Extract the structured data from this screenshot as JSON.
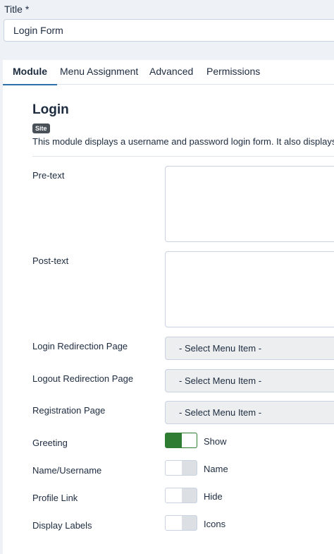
{
  "title_field": {
    "label": "Title *",
    "value": "Login Form"
  },
  "tabs": [
    {
      "label": "Module",
      "active": true
    },
    {
      "label": "Menu Assignment",
      "active": false
    },
    {
      "label": "Advanced",
      "active": false
    },
    {
      "label": "Permissions",
      "active": false
    }
  ],
  "module": {
    "title": "Login",
    "badge": "Site",
    "description": "This module displays a username and password login form. It also displays a"
  },
  "fields": {
    "pretext": {
      "label": "Pre-text"
    },
    "posttext": {
      "label": "Post-text"
    },
    "login_redirect": {
      "label": "Login Redirection Page",
      "selected": "- Select Menu Item -"
    },
    "logout_redirect": {
      "label": "Logout Redirection Page",
      "selected": "- Select Menu Item -"
    },
    "registration": {
      "label": "Registration Page",
      "selected": "- Select Menu Item -"
    },
    "greeting": {
      "label": "Greeting",
      "state": "on",
      "value": "Show"
    },
    "name_username": {
      "label": "Name/Username",
      "state": "off",
      "value": "Name"
    },
    "profile_link": {
      "label": "Profile Link",
      "state": "off",
      "value": "Hide"
    },
    "display_labels": {
      "label": "Display Labels",
      "state": "off",
      "value": "Icons"
    }
  },
  "colors": {
    "accent": "#3071a9",
    "switch_on": "#2e7d32"
  }
}
